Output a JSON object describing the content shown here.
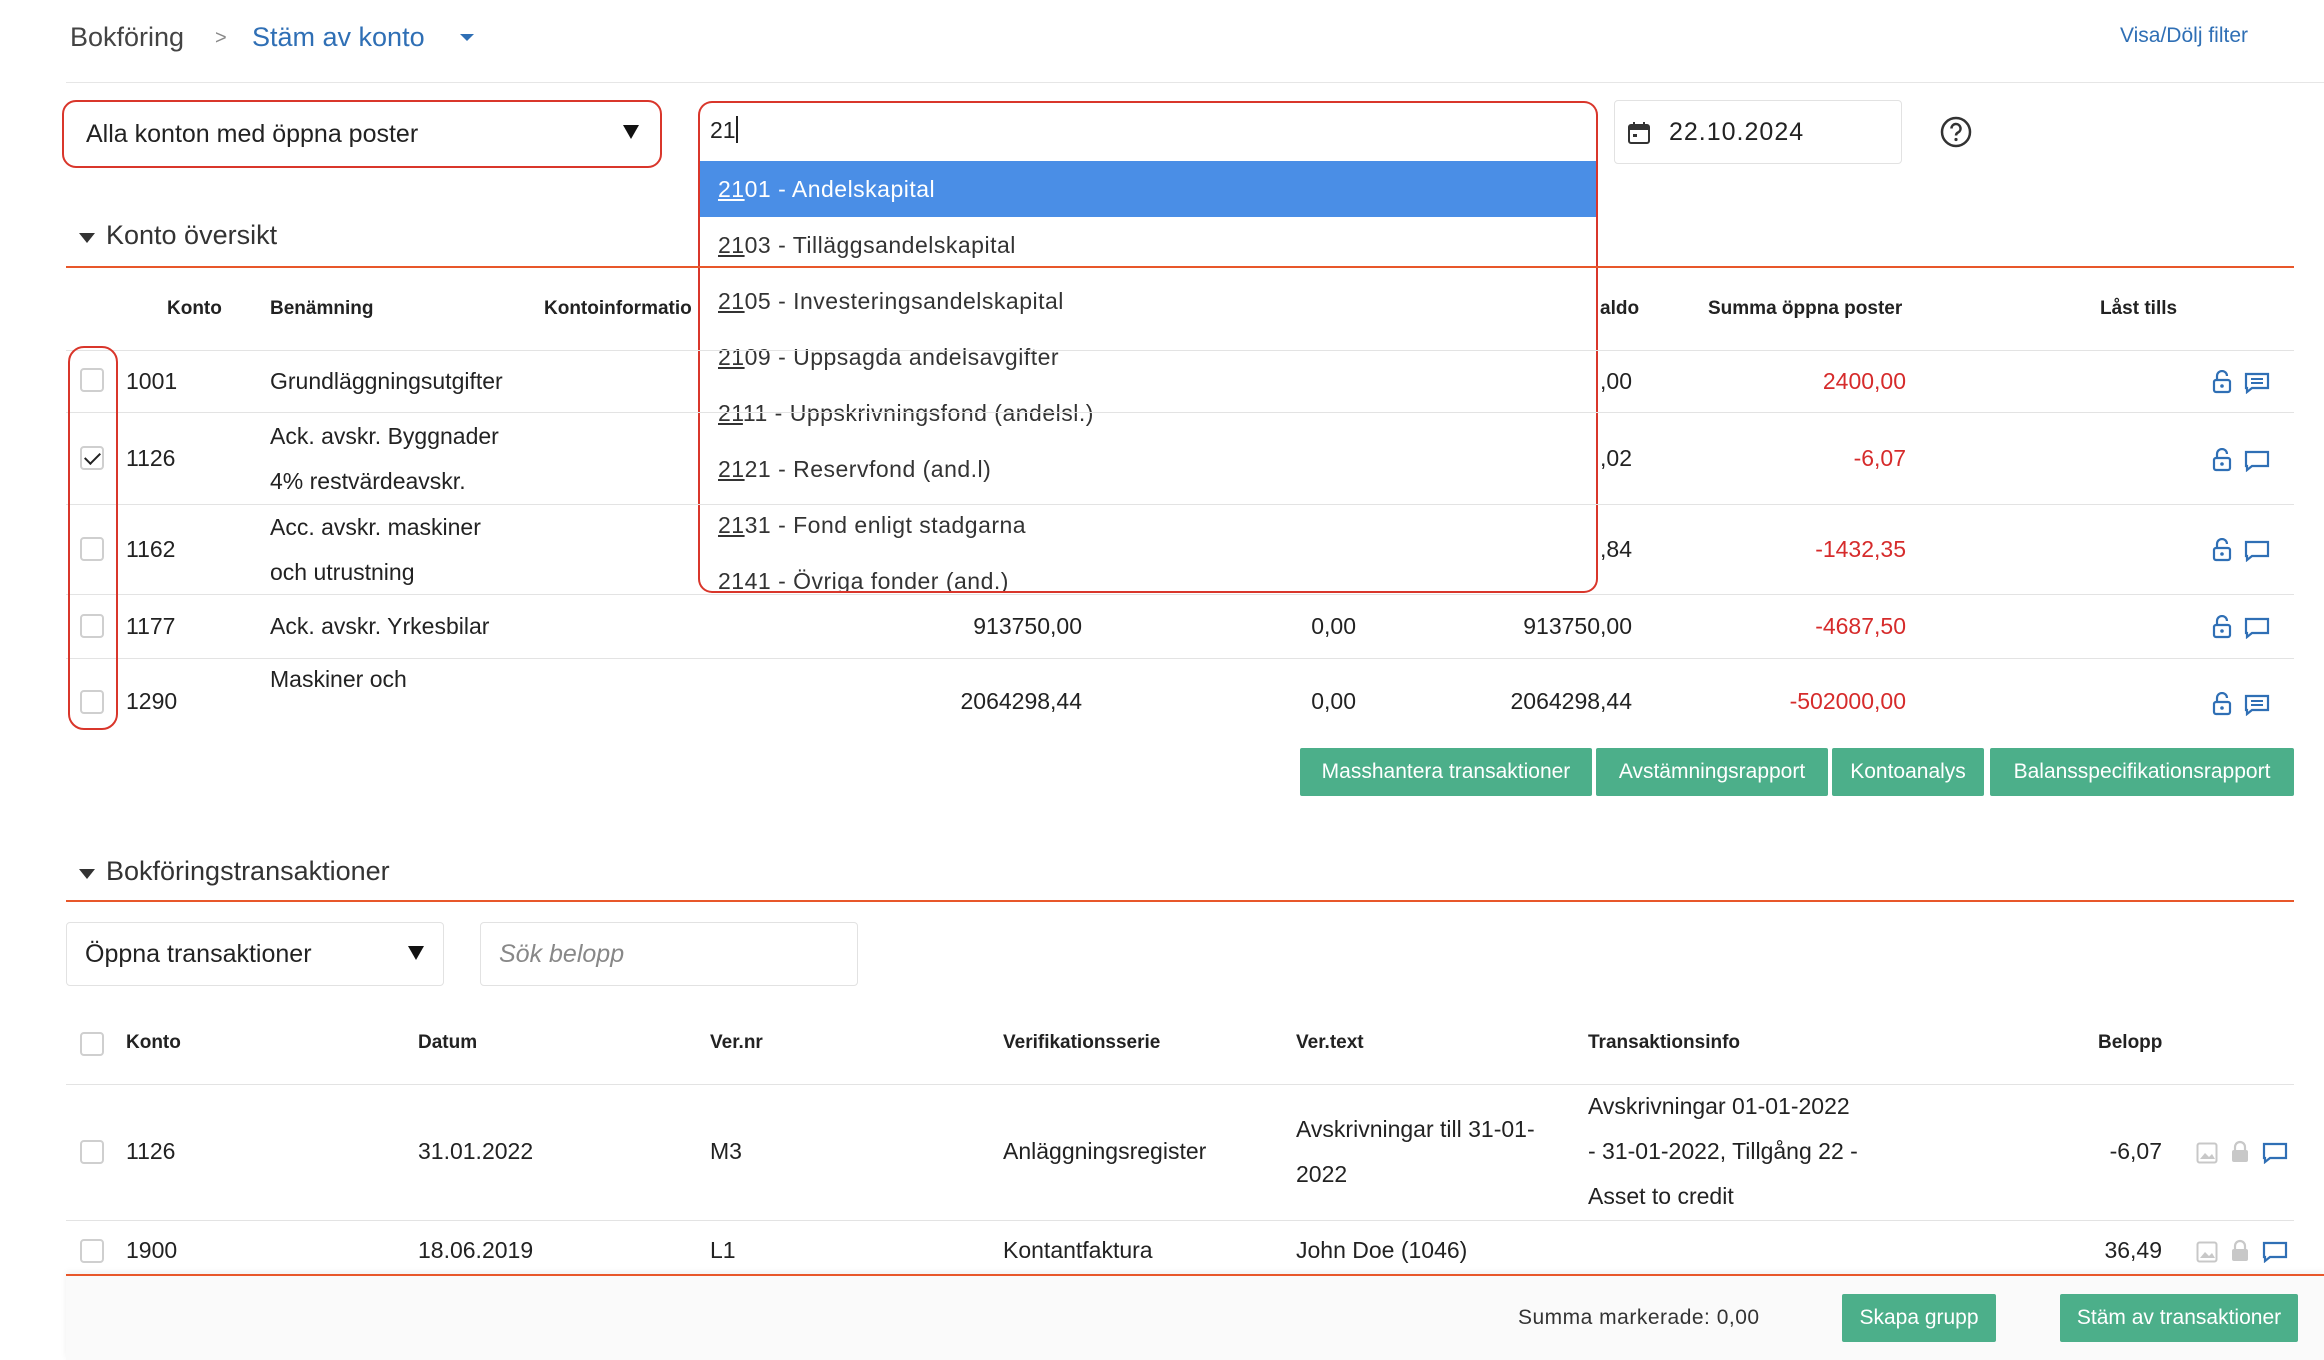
{
  "breadcrumb": {
    "root": "Bokföring",
    "separator": ">",
    "current": "Stäm av konto"
  },
  "filter_toggle": "Visa/Dölj filter",
  "account_select": {
    "value": "Alla konton med öppna poster"
  },
  "search_input": {
    "value": "21"
  },
  "date_field": {
    "value": "22.10.2024"
  },
  "dropdown": {
    "items": [
      {
        "prefix": "21",
        "rest": "01 - Andelskapital"
      },
      {
        "prefix": "21",
        "rest": "03 - Tilläggsandelskapital"
      },
      {
        "prefix": "21",
        "rest": "05 - Investeringsandelskapital"
      },
      {
        "prefix": "21",
        "rest": "09 - Uppsagda andelsavgifter"
      },
      {
        "prefix": "21",
        "rest": "11 - Uppskrivningsfond (andelsl.)"
      },
      {
        "prefix": "21",
        "rest": "21 - Reservfond (and.l)"
      },
      {
        "prefix": "21",
        "rest": "31 - Fond enligt stadgarna"
      },
      {
        "prefix": "21",
        "rest": "41 - Övriga fonder (and.)"
      }
    ]
  },
  "overview": {
    "title": "Konto översikt",
    "headers": {
      "konto": "Konto",
      "benamning": "Benämning",
      "kontoinfo": "Kontoinformatio",
      "saldo": "aldo",
      "summa": "Summa öppna poster",
      "last": "Låst tills"
    },
    "rows": [
      {
        "konto": "1001",
        "name1": "Grundläggningsutgifter",
        "name2": "",
        "c1": "",
        "c2": "",
        "c3": ",00",
        "summa": "2400,00",
        "checked": false
      },
      {
        "konto": "1126",
        "name1": "Ack. avskr. Byggnader",
        "name2": "4% restvärdeavskr.",
        "c1": "",
        "c2": "",
        "c3": ",02",
        "summa": "-6,07",
        "checked": true
      },
      {
        "konto": "1162",
        "name1": "Acc. avskr. maskiner",
        "name2": "och utrustning",
        "c1": "",
        "c2": "",
        "c3": ",84",
        "summa": "-1432,35",
        "checked": false
      },
      {
        "konto": "1177",
        "name1": "Ack. avskr. Yrkesbilar",
        "name2": "",
        "c1": "913750,00",
        "c2": "0,00",
        "c3": "913750,00",
        "summa": "-4687,50",
        "checked": false
      },
      {
        "konto": "1290",
        "name1": "Maskiner och",
        "name2": "",
        "c1": "2064298,44",
        "c2": "0,00",
        "c3": "2064298,44",
        "summa": "-502000,00",
        "checked": false
      }
    ],
    "buttons": {
      "mass": "Masshantera transaktioner",
      "avst": "Avstämningsrapport",
      "konto": "Kontoanalys",
      "balans": "Balansspecifikationsrapport"
    }
  },
  "transactions": {
    "title": "Bokföringstransaktioner",
    "filter_value": "Öppna transaktioner",
    "amount_placeholder": "Sök belopp",
    "headers": {
      "konto": "Konto",
      "datum": "Datum",
      "vernr": "Ver.nr",
      "serie": "Verifikationsserie",
      "vertext": "Ver.text",
      "info": "Transaktionsinfo",
      "belopp": "Belopp"
    },
    "rows": [
      {
        "konto": "1126",
        "datum": "31.01.2022",
        "vernr": "M3",
        "serie": "Anläggningsregister",
        "vertext1": "Avskrivningar till 31-01-",
        "vertext2": "2022",
        "info1": "Avskrivningar 01-01-2022",
        "info2": "- 31-01-2022, Tillgång 22 -",
        "info3": "Asset to credit",
        "belopp": "-6,07"
      },
      {
        "konto": "1900",
        "datum": "18.06.2019",
        "vernr": "L1",
        "serie": "Kontantfaktura",
        "vertext1": "John Doe (1046)",
        "vertext2": "",
        "info1": "",
        "info2": "",
        "info3": "",
        "belopp": "36,49"
      }
    ]
  },
  "footer": {
    "sum_label": "Summa markerade: 0,00",
    "create_group": "Skapa grupp",
    "reconcile": "Stäm av transaktioner"
  },
  "colors": {
    "accent_orange": "#e8572a",
    "highlight_red": "#d62b2b",
    "button_green": "#4caf8a",
    "link_blue": "#2f6fb5",
    "dropdown_selected": "#4a8ee6"
  }
}
